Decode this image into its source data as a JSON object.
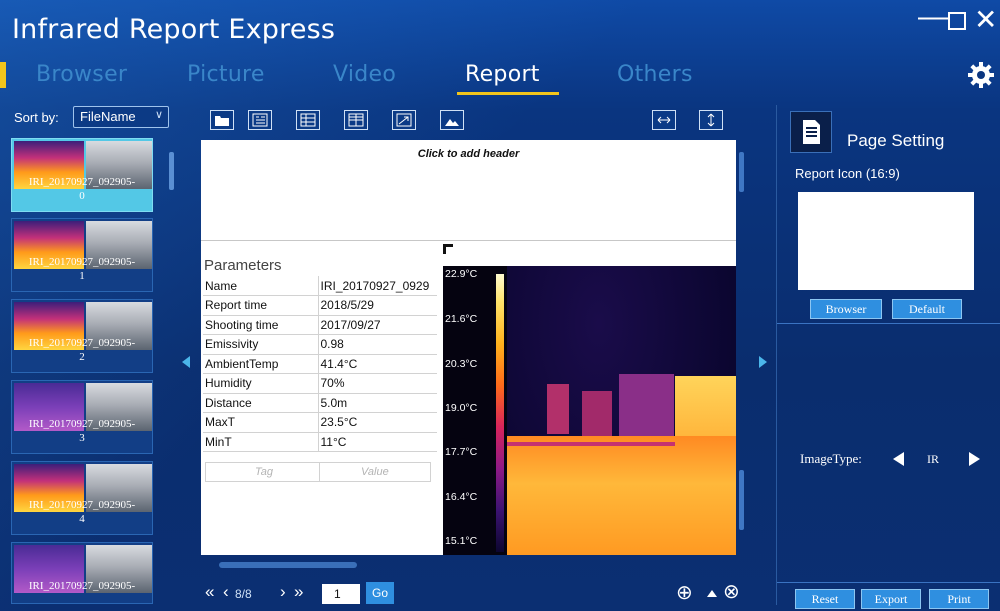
{
  "app": {
    "title": "Infrared Report Express"
  },
  "window_controls": {
    "minimize": "—",
    "close": "✕"
  },
  "tabs": [
    {
      "label": "Browser",
      "active": false
    },
    {
      "label": "Picture",
      "active": false
    },
    {
      "label": "Video",
      "active": false
    },
    {
      "label": "Report",
      "active": true
    },
    {
      "label": "Others",
      "active": false
    }
  ],
  "sidebar": {
    "sort_label": "Sort by:",
    "sort_value": "FileName",
    "thumbnails": [
      {
        "line1": "IRI_20170927_092905-",
        "line2": "0",
        "selected": true,
        "palette": "iron"
      },
      {
        "line1": "IRI_20170927_092905-",
        "line2": "1",
        "selected": false,
        "palette": "iron"
      },
      {
        "line1": "IRI_20170927_092905-",
        "line2": "2",
        "selected": false,
        "palette": "iron"
      },
      {
        "line1": "IRI_20170927_092905-",
        "line2": "3",
        "selected": false,
        "palette": "purple"
      },
      {
        "line1": "IRI_20170927_092905-",
        "line2": "4",
        "selected": false,
        "palette": "iron"
      },
      {
        "line1": "IRI_20170927_092905-",
        "line2": "",
        "selected": false,
        "palette": "purple"
      }
    ]
  },
  "toolbar": {
    "icons": [
      "folder-icon",
      "text-box-icon",
      "table-icon",
      "table-split-icon",
      "arrow-icon",
      "image-icon",
      "fit-width-icon",
      "fit-height-icon"
    ]
  },
  "report": {
    "header_hint": "Click to add header",
    "params_title": "Parameters",
    "params": [
      {
        "key": "Name",
        "value": "IRI_20170927_0929"
      },
      {
        "key": "Report time",
        "value": "2018/5/29"
      },
      {
        "key": "Shooting time",
        "value": "2017/09/27"
      },
      {
        "key": "Emissivity",
        "value": "0.98"
      },
      {
        "key": "AmbientTemp",
        "value": "41.4°C"
      },
      {
        "key": "Humidity",
        "value": "70%"
      },
      {
        "key": "Distance",
        "value": "5.0m"
      },
      {
        "key": "MaxT",
        "value": "23.5°C"
      },
      {
        "key": "MinT",
        "value": "11°C"
      }
    ],
    "tag_placeholder": "Tag",
    "value_placeholder": "Value",
    "scale_labels": [
      "22.9°C",
      "21.6°C",
      "20.3°C",
      "19.0°C",
      "17.7°C",
      "16.4°C",
      "15.1°C"
    ]
  },
  "pager": {
    "first": "«",
    "prev": "‹",
    "status": "8/8",
    "next": "›",
    "last": "»",
    "page_value": "1",
    "go_label": "Go"
  },
  "zoom": {
    "zoom_in": "⊕",
    "zoom_reset": "⊗"
  },
  "right_panel": {
    "page_setting": "Page Setting",
    "report_icon_label": "Report Icon (16:9)",
    "browser_button": "Browser",
    "default_button": "Default",
    "image_type_label": "ImageType:",
    "image_type_value": "IR",
    "reset_button": "Reset",
    "export_button": "Export",
    "print_button": "Print"
  },
  "colors": {
    "accent": "#f2c51c",
    "inactive_tab": "#3a86c9",
    "button": "#2f8fe0",
    "background": "#0a2d6e"
  }
}
